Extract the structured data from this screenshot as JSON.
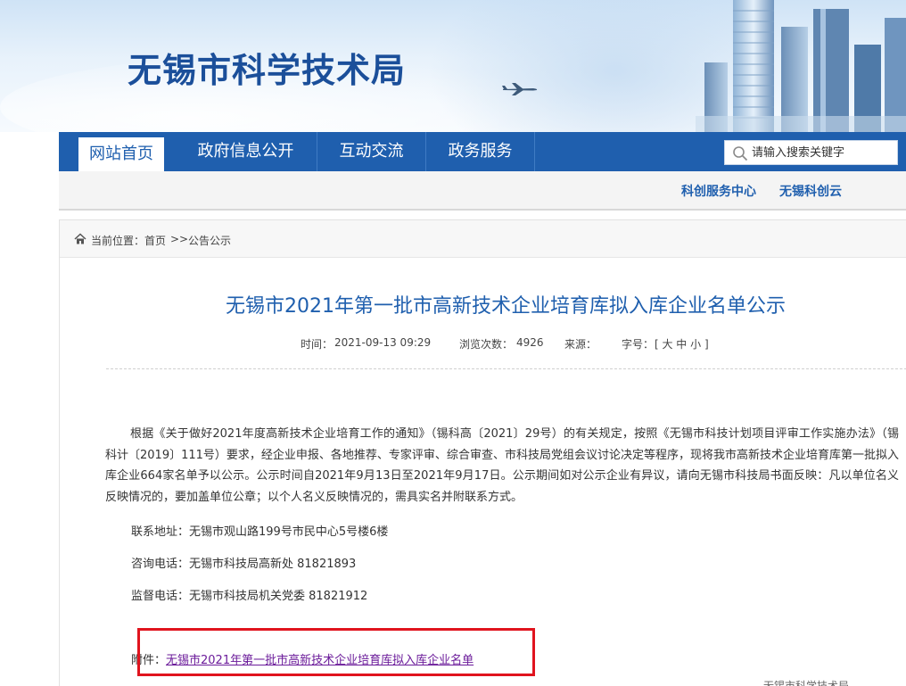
{
  "site": {
    "title": "无锡市科学技术局"
  },
  "nav": {
    "items": [
      {
        "label": "网站首页",
        "active": true
      },
      {
        "label": "政府信息公开"
      },
      {
        "label": "互动交流"
      },
      {
        "label": "政务服务"
      }
    ],
    "search_placeholder": "请输入搜索关键字"
  },
  "subnav": {
    "links": [
      "科创服务中心",
      "无锡科创云"
    ]
  },
  "breadcrumb": {
    "prefix": "当前位置：",
    "home": "首页",
    "sep": ">>",
    "current": "公告公示"
  },
  "article": {
    "title": "无锡市2021年第一批市高新技术企业培育库拟入库企业名单公示",
    "meta": {
      "time_label": "时间：",
      "time": "2021-09-13 09:29",
      "views_label": "浏览次数：",
      "views": "4926",
      "source_label": "来源：",
      "font_label": "字号：",
      "font_sizes": "[ 大 中 小 ]"
    },
    "body": "根据《关于做好2021年度高新技术企业培育工作的通知》（锡科高〔2021〕29号）的有关规定，按照《无锡市科技计划项目评审工作实施办法》（锡科计〔2019〕111号）要求，经企业申报、各地推荐、专家评审、综合审查、市科技局党组会议讨论决定等程序，现将我市高新技术企业培育库第一批拟入库企业664家名单予以公示。公示时间自2021年9月13日至2021年9月17日。公示期间如对公示企业有异议，请向无锡市科技局书面反映：凡以单位名义反映情况的，要加盖单位公章；以个人名义反映情况的，需具实名并附联系方式。",
    "address": "联系地址：无锡市观山路199号市民中心5号楼6楼",
    "consult": "咨询电话：无锡市科技局高新处   81821893",
    "supervise": "监督电话：无锡市科技局机关党委   81821912",
    "attachment_label": "附件：",
    "attachment_link": "无锡市2021年第一批市高新技术企业培育库拟入库企业名单"
  },
  "footer_peek": "无锡市科学技术局",
  "colors": {
    "brand": "#1f5fae",
    "title": "#1b4f9a",
    "highlight": "#e0141e",
    "link_visited": "#6b1b9a"
  }
}
